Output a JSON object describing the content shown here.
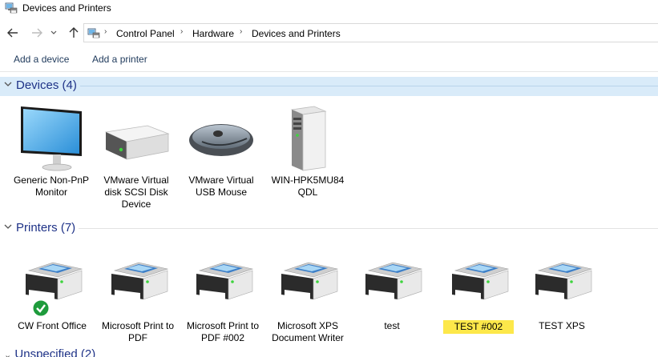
{
  "window": {
    "title": "Devices and Printers"
  },
  "breadcrumb": [
    "Control Panel",
    "Hardware",
    "Devices and Printers"
  ],
  "commands": {
    "add_device": "Add a device",
    "add_printer": "Add a printer"
  },
  "devices_group": {
    "title": "Devices (4)"
  },
  "devices": [
    {
      "name": "Generic Non-PnP Monitor",
      "icon": "monitor-icon"
    },
    {
      "name": "VMware Virtual disk SCSI Disk Device",
      "icon": "disk-drive-icon"
    },
    {
      "name": "VMware Virtual USB Mouse",
      "icon": "mouse-icon"
    },
    {
      "name": "WIN-HPK5MU84 QDL",
      "icon": "computer-tower-icon"
    }
  ],
  "printers_group": {
    "title": "Printers (7)"
  },
  "printers": [
    {
      "name": "CW Front Office",
      "icon": "printer-icon",
      "default": true
    },
    {
      "name": "Microsoft Print to PDF",
      "icon": "printer-icon"
    },
    {
      "name": "Microsoft Print to PDF #002",
      "icon": "printer-icon"
    },
    {
      "name": "Microsoft XPS Document Writer",
      "icon": "printer-icon"
    },
    {
      "name": "test",
      "icon": "printer-icon"
    },
    {
      "name": "TEST #002",
      "icon": "printer-icon",
      "selected": true
    },
    {
      "name": "TEST XPS",
      "icon": "printer-icon"
    }
  ],
  "unspecified_group": {
    "title": "Unspecified (2)"
  },
  "colors": {
    "group_title": "#1e3287",
    "selection": "#fde84a",
    "band": "#d9ebf9"
  }
}
